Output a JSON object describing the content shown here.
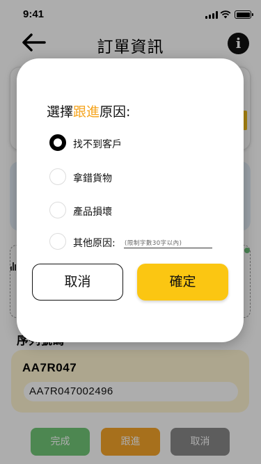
{
  "status_bar": {
    "time": "9:41"
  },
  "header": {
    "title": "訂單資訊",
    "back_icon": "arrow-left-icon",
    "info_icon": "info-icon",
    "info_glyph": "i"
  },
  "background": {
    "section_label": "序列號碼",
    "serial": {
      "code": "AA7R047",
      "value": "AA7R047002496"
    },
    "buttons": {
      "complete": "完成",
      "follow_up": "跟進",
      "cancel": "取消"
    }
  },
  "dialog": {
    "title_prefix": "選擇",
    "title_highlight": "跟進",
    "title_suffix": "原因:",
    "highlight_color": "#f5a41e",
    "options": [
      {
        "label": "找不到客戶",
        "checked": true
      },
      {
        "label": "拿錯貨物",
        "checked": false
      },
      {
        "label": "產品損壞",
        "checked": false
      },
      {
        "label": "其他原因:",
        "checked": false
      }
    ],
    "other_placeholder": "(限制字數30字以內)",
    "cancel_label": "取消",
    "confirm_label": "確定",
    "confirm_color": "#fbc612"
  }
}
